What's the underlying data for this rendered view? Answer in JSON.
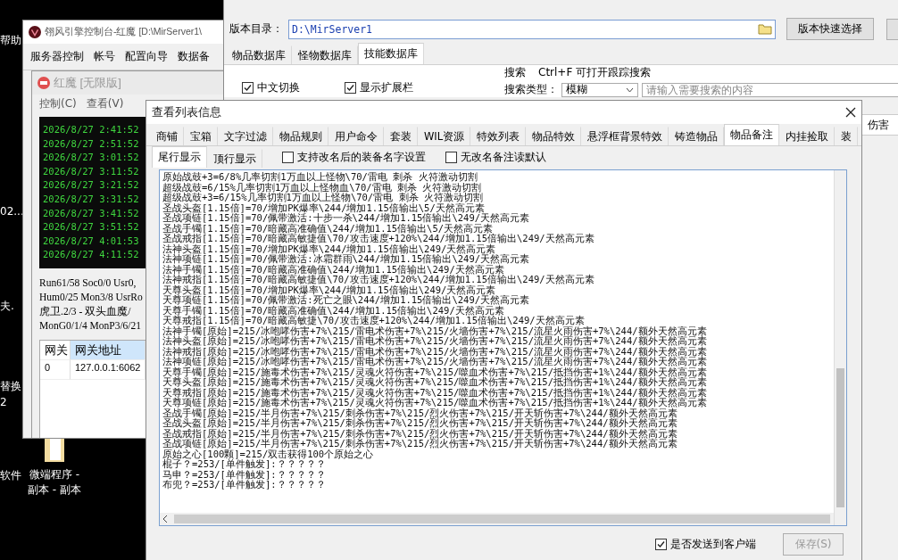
{
  "desktop": {
    "labels": [
      "帮助",
      "02...",
      "夫.",
      "替换",
      "2",
      "软件"
    ],
    "icons": [
      {
        "label": "微端程序 - 副本 - 副本"
      }
    ]
  },
  "console_window": {
    "title": "翎风引擎控制台-红魔 [D:\\MirServer1\\",
    "menu": [
      "服务器控制",
      "帐号",
      "配置向导",
      "数据备"
    ],
    "inner": {
      "title": "红魔 [无限版]",
      "menu": [
        "控制(C)",
        "查看(V)"
      ],
      "log": [
        "2026/8/27 2:41:52",
        "2026/8/27 2:51:52",
        "2026/8/27 3:01:52",
        "2026/8/27 3:11:52",
        "2026/8/27 3:21:52",
        "2026/8/27 3:31:52",
        "2026/8/27 3:41:52",
        "2026/8/27 3:51:52",
        "2026/8/27 4:01:53",
        "2026/8/27 4:11:52"
      ],
      "status": [
        "Run61/58 Soc0/0 Usr0,",
        "Hum0/25 Mon3/8 UsrRo",
        "虎卫.2/3 - 双头血魔/",
        "MonG0/1/4 MonP3/6/21"
      ],
      "table": {
        "columns": [
          "网关",
          "网关地址"
        ],
        "rows": [
          [
            "0",
            "127.0.0.1:6062"
          ]
        ]
      }
    }
  },
  "editor_window": {
    "dir_label": "版本目录：",
    "dir_value": "D:\\MirServer1",
    "quick_button": "版本快速选择",
    "tabs": [
      {
        "label": "物品数据库",
        "selected": false
      },
      {
        "label": "怪物数据库",
        "selected": false
      },
      {
        "label": "技能数据库",
        "selected": true
      }
    ],
    "checks": [
      {
        "label": "中文切换",
        "checked": true
      },
      {
        "label": "显示扩展栏",
        "checked": true
      }
    ],
    "search_title": "搜索",
    "search_hint": "Ctrl+F 可打开跟踪搜索",
    "search_type_label": "搜索类型：",
    "search_type": "模糊",
    "search": {
      "placeholder": "请输入需要搜索的内容"
    },
    "column_header": "伤害"
  },
  "dialog": {
    "title": "查看列表信息",
    "tabs": [
      {
        "label": "商铺",
        "selected": false
      },
      {
        "label": "宝箱",
        "selected": false
      },
      {
        "label": "文字过滤",
        "selected": false
      },
      {
        "label": "物品规则",
        "selected": false
      },
      {
        "label": "用户命令",
        "selected": false
      },
      {
        "label": "套装",
        "selected": false
      },
      {
        "label": "WIL资源",
        "selected": false
      },
      {
        "label": "特效列表",
        "selected": false
      },
      {
        "label": "物品特效",
        "selected": false
      },
      {
        "label": "悬浮框背景特效",
        "selected": false
      },
      {
        "label": "铸造物品",
        "selected": false
      },
      {
        "label": "物品备注",
        "selected": true
      },
      {
        "label": "内挂捡取",
        "selected": false
      },
      {
        "label": "装",
        "selected": false
      }
    ],
    "subtabs": [
      {
        "label": "尾行显示",
        "selected": true
      },
      {
        "label": "顶行显示",
        "selected": false
      }
    ],
    "options": [
      {
        "label": "支持改名后的装备名字设置",
        "checked": false
      },
      {
        "label": "无改名备注读默认",
        "checked": false
      }
    ],
    "lines": [
      "原始战鼓+3=6/8%几率切割1万血以上怪物\\70/雷电 刺杀 火符激动切割",
      "超级战鼓=6/15%几率切割1万血以上怪物血\\70/雷电 刺杀 火符激动切割",
      "超级战鼓+3=6/15%几率切割1万血以上怪物\\70/雷电 刺杀 火符激动切割",
      "圣战头盔[1.15倍]=70/增加PK爆率\\244/增加1.15倍输出\\5/天然高元素",
      "圣战项链[1.15倍]=70/佩带激活:十步一杀\\244/增加1.15倍输出\\249/天然高元素",
      "圣战手镯[1.15倍]=70/暗藏高准确值\\244/增加1.15倍输出\\5/天然高元素",
      "圣战戒指[1.15倍]=70/暗藏高敏捷值\\70/攻击速度+120%\\244/增加1.15倍输出\\249/天然高元素",
      "法神头盔[1.15倍]=70/增加PK爆率\\244/增加1.15倍输出\\249/天然高元素",
      "法神项链[1.15倍]=70/佩带激活:冰霜群雨\\244/增加1.15倍输出\\249/天然高元素",
      "法神手镯[1.15倍]=70/暗藏高准确值\\244/增加1.15倍输出\\249/天然高元素",
      "法神戒指[1.15倍]=70/暗藏高敏捷值\\70/攻击速度+120%\\244/增加1.15倍输出\\249/天然高元素",
      "天尊头盔[1.15倍]=70/增加PK爆率\\244/增加1.15倍输出\\249/天然高元素",
      "天尊项链[1.15倍]=70/佩带激活:死亡之眼\\244/增加1.15倍输出\\249/天然高元素",
      "天尊手镯[1.15倍]=70/暗藏高准确值\\244/增加1.15倍输出\\249/天然高元素",
      "天尊戒指[1.15倍]=70/暗藏高敏捷\\70/攻击速度+120%\\244/增加1.15倍输出\\249/天然高元素",
      "法神手镯[原始]=215/冰咆哮伤害+7%\\215/雷电术伤害+7%\\215/火墙伤害+7%\\215/流星火雨伤害+7%\\244/额外天然高元素",
      "法神头盔[原始]=215/冰咆哮伤害+7%\\215/雷电术伤害+7%\\215/火墙伤害+7%\\215/流星火雨伤害+7%\\244/额外天然高元素",
      "法神戒指[原始]=215/冰咆哮伤害+7%\\215/雷电术伤害+7%\\215/火墙伤害+7%\\215/流星火雨伤害+7%\\244/额外天然高元素",
      "法神项链[原始]=215/冰咆哮伤害+7%\\215/雷电术伤害+7%\\215/火墙伤害+7%\\215/流星火雨伤害+7%\\244/额外天然高元素",
      "天尊手镯[原始]=215/施毒术伤害+7%\\215/灵魂火符伤害+7%\\215/噬血术伤害+7%\\215/抵挡伤害+1%\\244/额外天然高元素",
      "天尊头盔[原始]=215/施毒术伤害+7%\\215/灵魂火符伤害+7%\\215/噬血术伤害+7%\\215/抵挡伤害+1%\\244/额外天然高元素",
      "天尊戒指[原始]=215/施毒术伤害+7%\\215/灵魂火符伤害+7%\\215/噬血术伤害+7%\\215/抵挡伤害+1%\\244/额外天然高元素",
      "天尊项链[原始]=215/施毒术伤害+7%\\215/灵魂火符伤害+7%\\215/噬血术伤害+7%\\215/抵挡伤害+1%\\244/额外天然高元素",
      "圣战手镯[原始]=215/半月伤害+7%\\215/刺杀伤害+7%\\215/烈火伤害+7%\\215/开天斩伤害+7%\\244/额外天然高元素",
      "圣战头盔[原始]=215/半月伤害+7%\\215/刺杀伤害+7%\\215/烈火伤害+7%\\215/开天斩伤害+7%\\244/额外天然高元素",
      "圣战戒指[原始]=215/半月伤害+7%\\215/刺杀伤害+7%\\215/烈火伤害+7%\\215/开天斩伤害+7%\\244/额外天然高元素",
      "圣战项链[原始]=215/半月伤害+7%\\215/刺杀伤害+7%\\215/烈火伤害+7%\\215/开天斩伤害+7%\\244/额外天然高元素",
      "原始之心[100颗]=215/双击获得100个原始之心",
      "棍子？=253/[单件触发]:？？？？？",
      "马申？=253/[单件触发]:？？？？？",
      "布兜？=253/[单件触发]:？？？？？"
    ],
    "send_to_client": {
      "label": "是否发送到客户端",
      "checked": true
    },
    "save_button": {
      "label": "保存(S)",
      "disabled": true
    }
  }
}
